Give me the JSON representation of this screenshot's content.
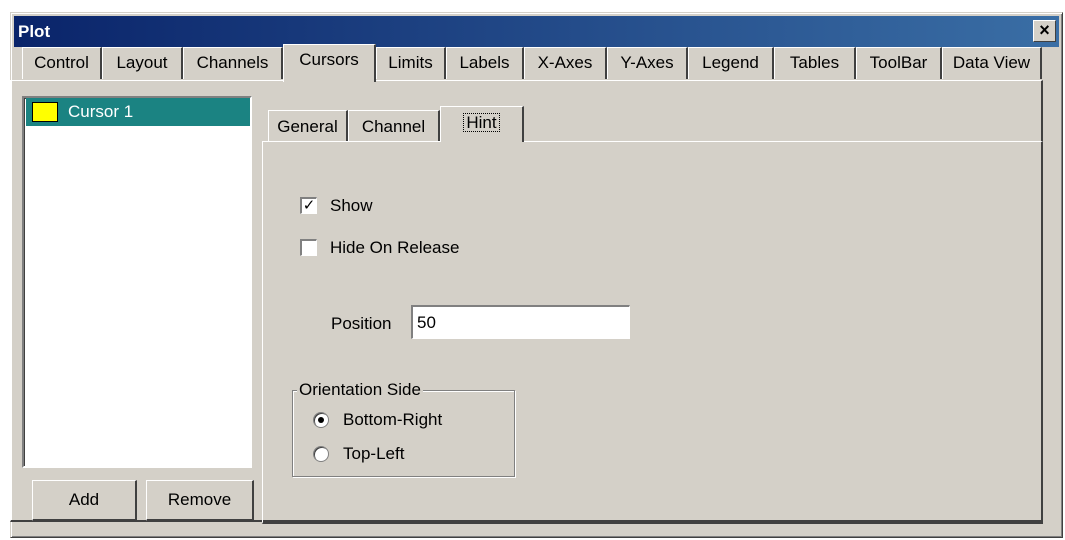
{
  "window": {
    "title": "Plot",
    "close_label": "×"
  },
  "tabs": [
    {
      "label": "Control"
    },
    {
      "label": "Layout"
    },
    {
      "label": "Channels"
    },
    {
      "label": "Cursors",
      "active": true
    },
    {
      "label": "Limits"
    },
    {
      "label": "Labels"
    },
    {
      "label": "X-Axes"
    },
    {
      "label": "Y-Axes"
    },
    {
      "label": "Legend"
    },
    {
      "label": "Tables"
    },
    {
      "label": "ToolBar"
    },
    {
      "label": "Data View"
    }
  ],
  "cursor_list": {
    "items": [
      {
        "label": "Cursor 1",
        "color": "#ffff00",
        "selected": true
      }
    ],
    "add_label": "Add",
    "remove_label": "Remove"
  },
  "subtabs": [
    {
      "label": "General"
    },
    {
      "label": "Channel"
    },
    {
      "label": "Hint",
      "active": true
    }
  ],
  "hint": {
    "show": {
      "label": "Show",
      "checked": true
    },
    "hide_on_release": {
      "label": "Hide On Release",
      "checked": false
    },
    "position": {
      "label": "Position",
      "value": "50"
    },
    "orientation": {
      "title": "Orientation Side",
      "options": [
        {
          "label": "Bottom-Right",
          "selected": true
        },
        {
          "label": "Top-Left",
          "selected": false
        }
      ]
    }
  },
  "colors": {
    "title_bar": "#0a246a",
    "selection": "#1b8382",
    "face": "#d4d0c8"
  }
}
